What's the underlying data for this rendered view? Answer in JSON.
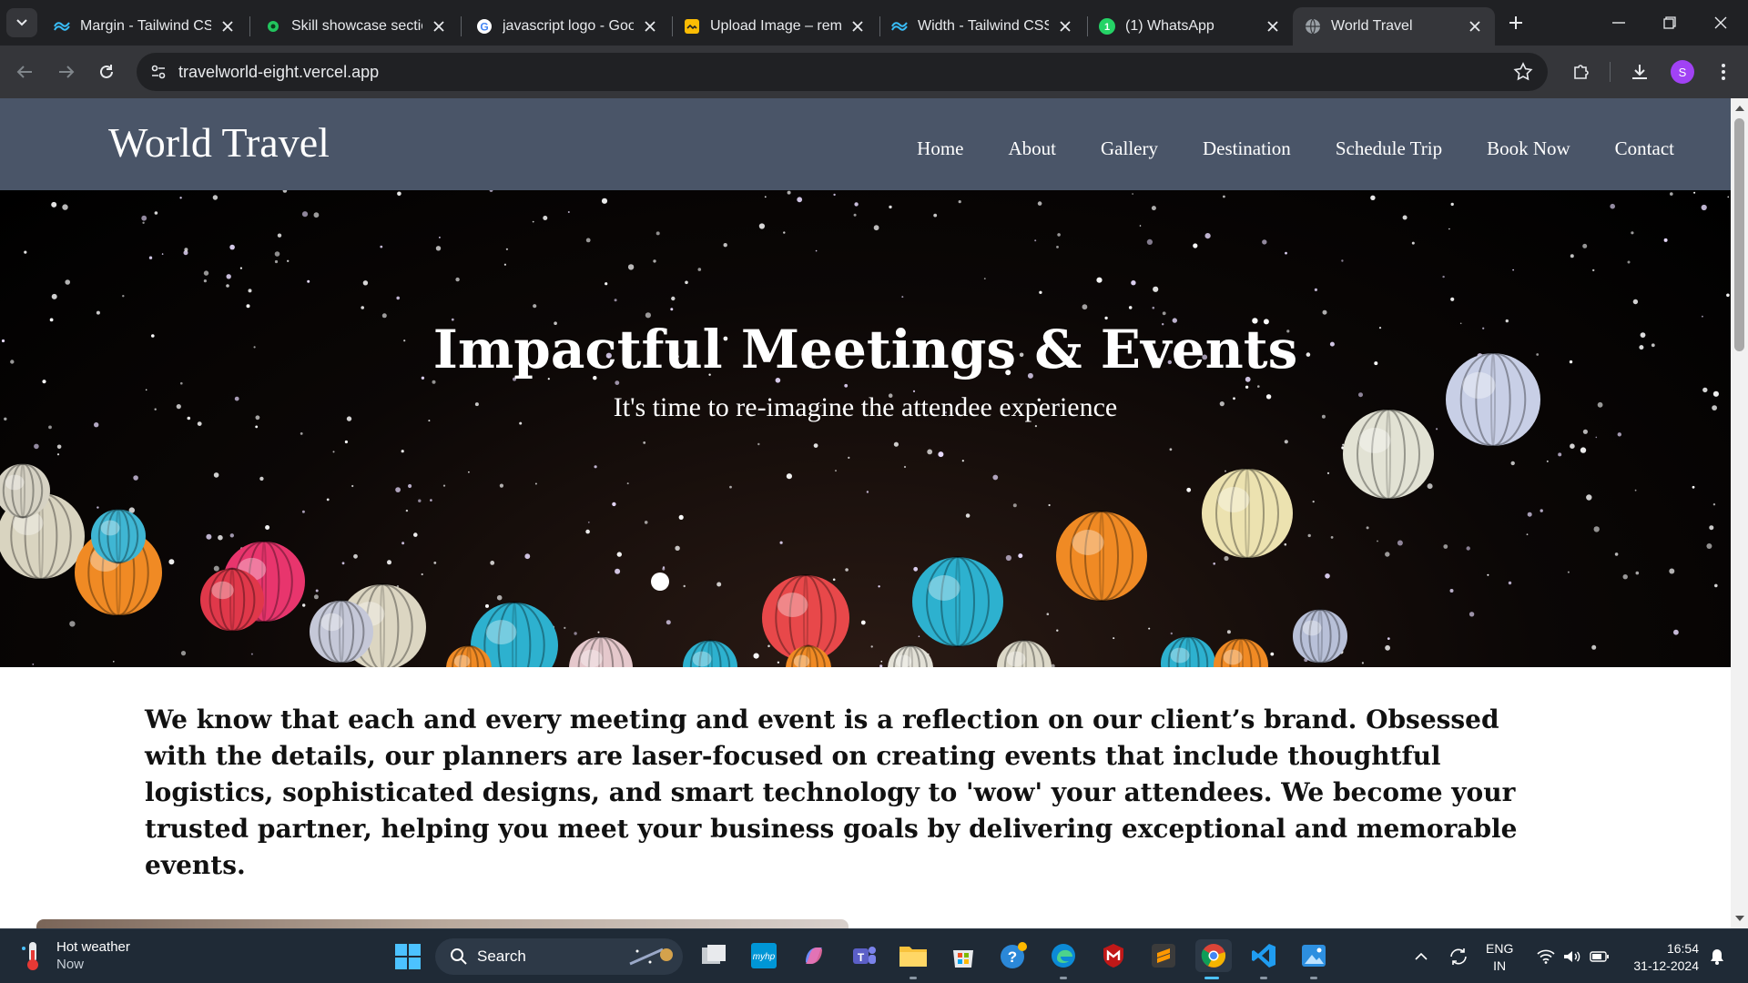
{
  "browser": {
    "tabs": [
      {
        "title": "Margin - Tailwind CSS",
        "icon": "tailwind-icon",
        "active": false
      },
      {
        "title": "Skill showcase section",
        "icon": "leaf-icon",
        "active": false
      },
      {
        "title": "javascript logo - Google",
        "icon": "google-icon",
        "active": false
      },
      {
        "title": "Upload Image – remove",
        "icon": "upload-icon",
        "active": false
      },
      {
        "title": "Width - Tailwind CSS",
        "icon": "tailwind-icon",
        "active": false
      },
      {
        "title": "(1) WhatsApp",
        "icon": "whatsapp-icon",
        "active": false,
        "badge": "1"
      },
      {
        "title": "World Travel",
        "icon": "globe-icon",
        "active": true
      }
    ],
    "url": "travelworld-eight.vercel.app",
    "profile_initial": "S"
  },
  "site": {
    "brand": "World Travel",
    "nav": [
      "Home",
      "About",
      "Gallery",
      "Destination",
      "Schedule Trip",
      "Book Now",
      "Contact"
    ],
    "hero": {
      "title": "Impactful Meetings & Events",
      "subtitle": "It's time to re-imagine the attendee experience"
    },
    "intro": "We know that each and every meeting and event is a reflection on our client’s brand. Obsessed with the details, our planners are laser-focused on creating events that include thoughtful logistics, sophisticated designs, and smart technology to 'wow' your attendees. We become your trusted partner, helping you meet your business goals by delivering exceptional and memorable events."
  },
  "taskbar": {
    "weather": {
      "title": "Hot weather",
      "subtitle": "Now"
    },
    "search_label": "Search",
    "lang": {
      "line1": "ENG",
      "line2": "IN"
    },
    "clock": {
      "time": "16:54",
      "date": "31-12-2024"
    },
    "apps": [
      "task-view-icon",
      "myhp-icon",
      "copilot-icon",
      "teams-icon",
      "file-explorer-icon",
      "store-icon",
      "help-icon",
      "edge-icon",
      "mcafee-icon",
      "sublime-icon",
      "chrome-icon",
      "vscode-icon",
      "photos-icon"
    ]
  },
  "colors": {
    "site_nav": "#4a5568",
    "tab_strip": "#202124",
    "toolbar": "#35363a",
    "taskbar": "#1f2a36"
  }
}
